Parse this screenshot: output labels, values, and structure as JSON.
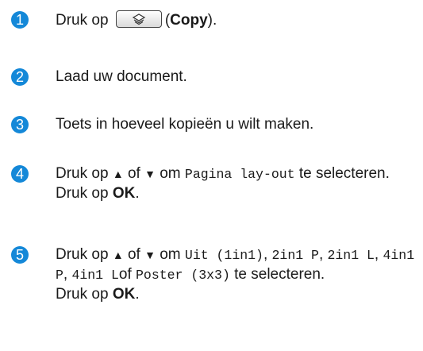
{
  "accent_color": "#1488d8",
  "steps": [
    {
      "number": "1",
      "pre": "Druk op",
      "button_icon": "copy-icon",
      "post_open": "(",
      "bold": "Copy",
      "post_close": ")."
    },
    {
      "number": "2",
      "text": "Laad uw document."
    },
    {
      "number": "3",
      "text": "Toets in hoeveel kopieën u wilt maken."
    },
    {
      "number": "4",
      "pre": "Druk op",
      "arrow_up": "▲",
      "of": "of",
      "arrow_down": "▼",
      "om": "om",
      "code": "Pagina lay-out",
      "post": "te selecteren.",
      "line2_pre": "Druk op",
      "line2_bold": "OK",
      "line2_post": "."
    },
    {
      "number": "5",
      "pre": "Druk op",
      "arrow_up": "▲",
      "of": "of",
      "arrow_down": "▼",
      "om": "om",
      "options": [
        "Uit (1in1)",
        "2in1 P",
        "2in1 L",
        "4in1 P",
        "4in1 L"
      ],
      "sep": ",",
      "of2": "of",
      "last_option": "Poster (3x3)",
      "post": "te selecteren.",
      "line2_pre": "Druk op",
      "line2_bold": "OK",
      "line2_post": "."
    }
  ]
}
